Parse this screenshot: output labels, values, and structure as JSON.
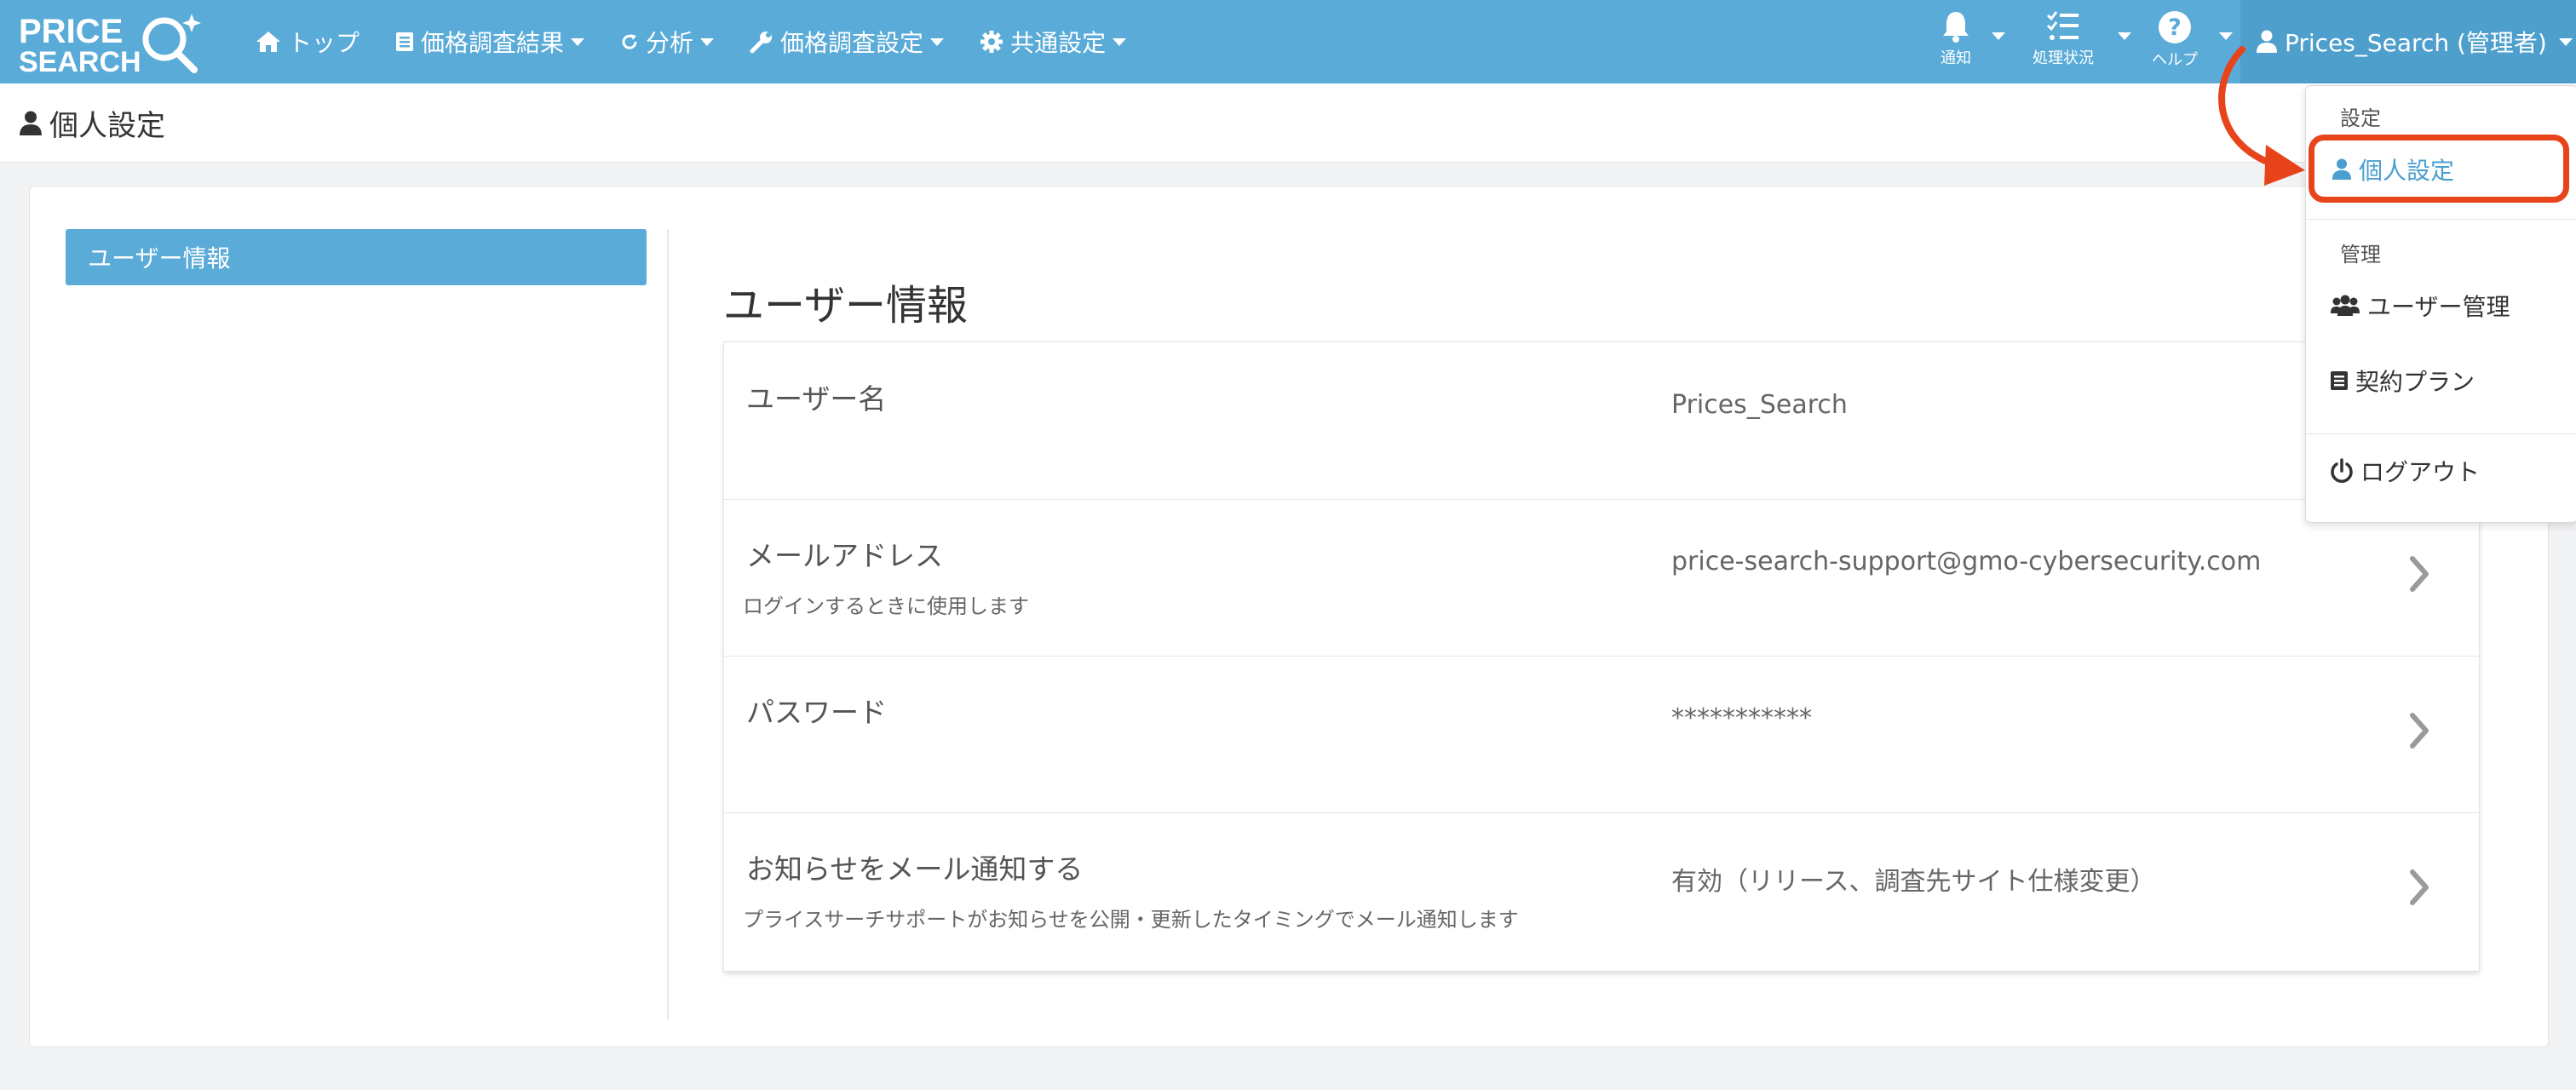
{
  "brand": {
    "logo_line1": "PRICE",
    "logo_line2": "SEARCH"
  },
  "nav": {
    "items": [
      {
        "label": "トップ",
        "icon": "home-icon",
        "has_caret": false
      },
      {
        "label": "価格調査結果",
        "icon": "list-icon",
        "has_caret": true
      },
      {
        "label": "分析",
        "icon": "refresh-icon",
        "has_caret": true
      },
      {
        "label": "価格調査設定",
        "icon": "wrench-icon",
        "has_caret": true
      },
      {
        "label": "共通設定",
        "icon": "gear-icon",
        "has_caret": true
      }
    ],
    "notifications_label": "通知",
    "processing_label": "処理状況",
    "help_label": "ヘルプ",
    "user_label": "Prices_Search (管理者)"
  },
  "page": {
    "title": "個人設定"
  },
  "sidebar": {
    "items": [
      {
        "label": "ユーザー情報",
        "active": true
      }
    ]
  },
  "section": {
    "title": "ユーザー情報"
  },
  "rows": [
    {
      "label": "ユーザー名",
      "sub": "",
      "value": "Prices_Search",
      "chevron": false
    },
    {
      "label": "メールアドレス",
      "sub": "ログインするときに使用します",
      "value": "price-search-support@gmo-cybersecurity.com",
      "chevron": true
    },
    {
      "label": "パスワード",
      "sub": "",
      "value": "***********",
      "chevron": true
    },
    {
      "label": "お知らせをメール通知する",
      "sub": "プライスサーチサポートがお知らせを公開・更新したタイミングでメール通知します",
      "value": "有効（リリース、調査先サイト仕様変更）",
      "chevron": true
    }
  ],
  "dropdown": {
    "header_settings": "設定",
    "personal_settings": "個人設定",
    "header_admin": "管理",
    "user_management": "ユーザー管理",
    "contract_plan": "契約プラン",
    "logout": "ログアウト"
  },
  "colors": {
    "navbar": "#5aabd8",
    "accent": "#4a9fd0",
    "annotation": "#e8441c"
  }
}
